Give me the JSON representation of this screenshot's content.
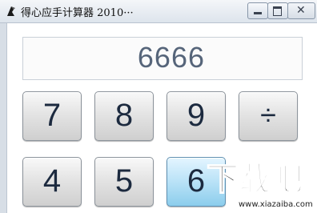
{
  "window": {
    "title": "得心应手计算器 2010···",
    "controls": {
      "minimize": "minimize",
      "maximize": "maximize",
      "close": "✕"
    }
  },
  "display": {
    "value": "6666"
  },
  "keys": [
    {
      "label": "7",
      "active": false
    },
    {
      "label": "8",
      "active": false
    },
    {
      "label": "9",
      "active": false
    },
    {
      "label": "÷",
      "active": false
    },
    {
      "label": "4",
      "active": false
    },
    {
      "label": "5",
      "active": false
    },
    {
      "label": "6",
      "active": true
    }
  ],
  "watermark": {
    "logo": "下载吧",
    "url": "www.xiazaiba.com"
  },
  "colors": {
    "display_text": "#56657a",
    "key_text": "#1c2a3f",
    "key_active": "#b9e2f7"
  }
}
